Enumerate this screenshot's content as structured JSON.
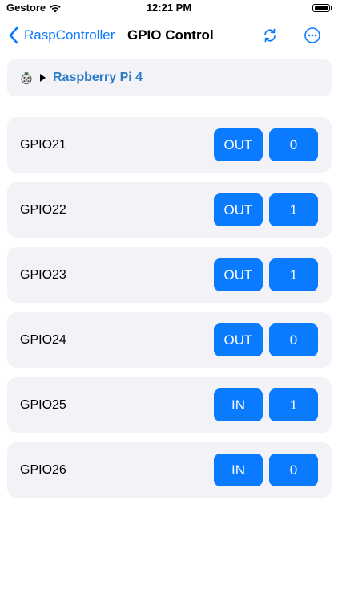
{
  "status_bar": {
    "carrier": "Gestore",
    "time": "12:21 PM"
  },
  "nav": {
    "back_label": "RaspController",
    "title": "GPIO Control"
  },
  "device": {
    "name": "Raspberry Pi 4"
  },
  "accent_color": "#0A7AFF",
  "gpios": [
    {
      "name": "GPIO21",
      "direction": "OUT",
      "value": "0"
    },
    {
      "name": "GPIO22",
      "direction": "OUT",
      "value": "1"
    },
    {
      "name": "GPIO23",
      "direction": "OUT",
      "value": "1"
    },
    {
      "name": "GPIO24",
      "direction": "OUT",
      "value": "0"
    },
    {
      "name": "GPIO25",
      "direction": "IN",
      "value": "1"
    },
    {
      "name": "GPIO26",
      "direction": "IN",
      "value": "0"
    }
  ]
}
